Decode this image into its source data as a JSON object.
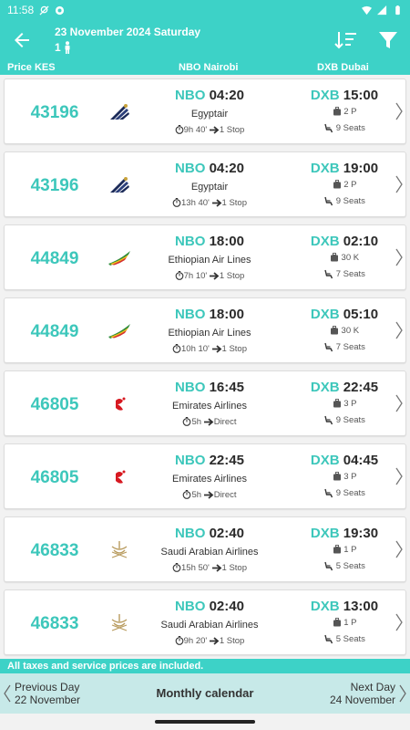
{
  "status_bar": {
    "time": "11:58"
  },
  "header": {
    "date_title": "23 November 2024 Saturday",
    "passengers": "1"
  },
  "columns": {
    "price": "Price KES",
    "origin": "NBO Nairobi",
    "destination": "DXB Dubai"
  },
  "flights": [
    {
      "price": "43196",
      "airline": "Egyptair",
      "logo": "egyptair-logo",
      "dep_code": "NBO",
      "dep_time": "04:20",
      "duration": "9h 40'",
      "stops": "1 Stop",
      "arr_code": "DXB",
      "arr_time": "15:00",
      "baggage": "2 P",
      "seats": "9 Seats"
    },
    {
      "price": "43196",
      "airline": "Egyptair",
      "logo": "egyptair-logo",
      "dep_code": "NBO",
      "dep_time": "04:20",
      "duration": "13h 40'",
      "stops": "1 Stop",
      "arr_code": "DXB",
      "arr_time": "19:00",
      "baggage": "2 P",
      "seats": "9 Seats"
    },
    {
      "price": "44849",
      "airline": "Ethiopian Air Lines",
      "logo": "ethiopian-logo",
      "dep_code": "NBO",
      "dep_time": "18:00",
      "duration": "7h 10'",
      "stops": "1 Stop",
      "arr_code": "DXB",
      "arr_time": "02:10",
      "baggage": "30 K",
      "seats": "7 Seats"
    },
    {
      "price": "44849",
      "airline": "Ethiopian Air Lines",
      "logo": "ethiopian-logo",
      "dep_code": "NBO",
      "dep_time": "18:00",
      "duration": "10h 10'",
      "stops": "1 Stop",
      "arr_code": "DXB",
      "arr_time": "05:10",
      "baggage": "30 K",
      "seats": "7 Seats"
    },
    {
      "price": "46805",
      "airline": "Emirates Airlines",
      "logo": "emirates-logo",
      "dep_code": "NBO",
      "dep_time": "16:45",
      "duration": "5h",
      "stops": "Direct",
      "arr_code": "DXB",
      "arr_time": "22:45",
      "baggage": "3 P",
      "seats": "9 Seats"
    },
    {
      "price": "46805",
      "airline": "Emirates Airlines",
      "logo": "emirates-logo",
      "dep_code": "NBO",
      "dep_time": "22:45",
      "duration": "5h",
      "stops": "Direct",
      "arr_code": "DXB",
      "arr_time": "04:45",
      "baggage": "3 P",
      "seats": "9 Seats"
    },
    {
      "price": "46833",
      "airline": "Saudi Arabian Airlines",
      "logo": "saudia-logo",
      "dep_code": "NBO",
      "dep_time": "02:40",
      "duration": "15h 50'",
      "stops": "1 Stop",
      "arr_code": "DXB",
      "arr_time": "19:30",
      "baggage": "1 P",
      "seats": "5 Seats"
    },
    {
      "price": "46833",
      "airline": "Saudi Arabian Airlines",
      "logo": "saudia-logo",
      "dep_code": "NBO",
      "dep_time": "02:40",
      "duration": "9h 20'",
      "stops": "1 Stop",
      "arr_code": "DXB",
      "arr_time": "13:00",
      "baggage": "1 P",
      "seats": "5 Seats"
    }
  ],
  "footer_note": "All taxes and service prices are included.",
  "bottom_nav": {
    "prev_label": "Previous Day",
    "prev_date": "22 November",
    "monthly": "Monthly calendar",
    "next_label": "Next Day",
    "next_date": "24 November"
  },
  "colors": {
    "accent": "#3dd2c7",
    "price": "#3dc7bb",
    "bottom_bar": "#c7e9e8"
  }
}
